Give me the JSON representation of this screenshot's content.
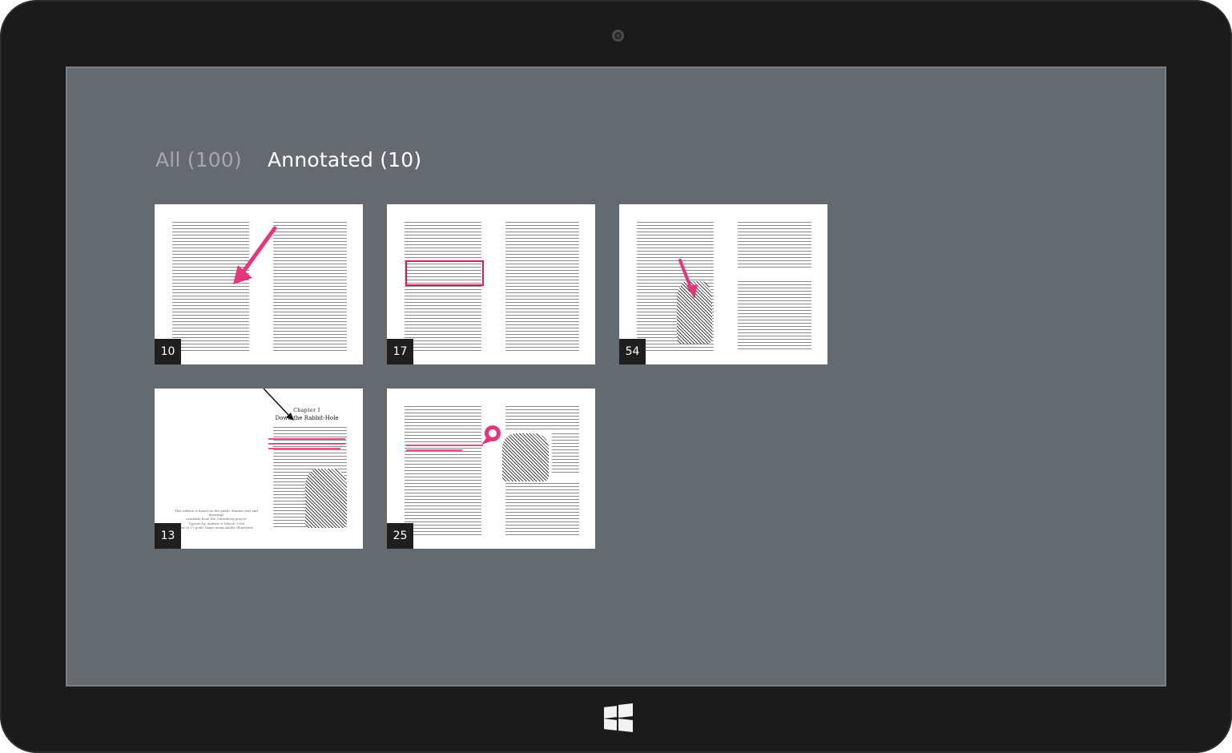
{
  "device": {
    "camera_icon": "camera-icon",
    "home_button_icon": "windows-logo-icon"
  },
  "tabs": [
    {
      "label": "All (100)",
      "state": "inactive"
    },
    {
      "label": "Annotated (10)",
      "state": "active"
    }
  ],
  "pages": [
    {
      "number": "10",
      "annotation": "pink-arrow"
    },
    {
      "number": "17",
      "annotation": "pink-rectangle"
    },
    {
      "number": "54",
      "annotation": "pink-arrow"
    },
    {
      "number": "13",
      "annotation": "black-arrow-and-strikethrough"
    },
    {
      "number": "25",
      "annotation": "strikethrough-and-note"
    }
  ],
  "chapter_page": {
    "chapter_label": "Chapter I",
    "chapter_title": "Down the Rabbit-Hole",
    "note_line1": "This edition is based on the public domain text and drawings",
    "note_line2": "available from the Gutenberg project",
    "note_line3": "Typeset by Andrew D Mauch 1996",
    "note_line4": "Set in 11 point Times using Adobe Illustrator"
  },
  "colors": {
    "screen_bg": "#656a70",
    "bezel": "#1b1b1b",
    "annotation_pink": "#e8347a",
    "tab_active": "#ffffff",
    "tab_inactive": "#a4a8ad"
  }
}
